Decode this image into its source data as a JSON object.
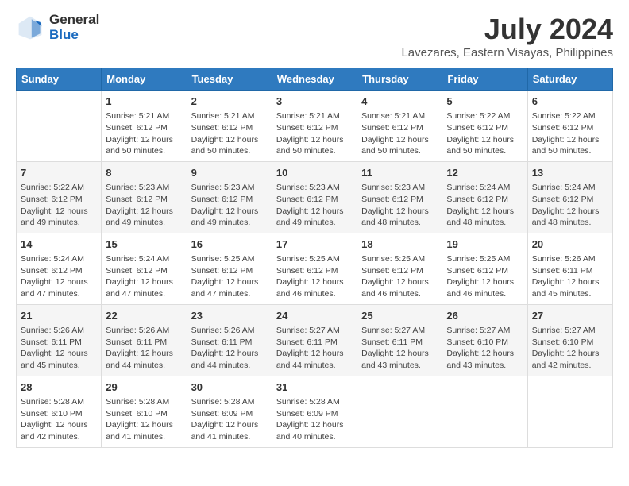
{
  "header": {
    "logo_line1": "General",
    "logo_line2": "Blue",
    "title": "July 2024",
    "subtitle": "Lavezares, Eastern Visayas, Philippines"
  },
  "columns": [
    "Sunday",
    "Monday",
    "Tuesday",
    "Wednesday",
    "Thursday",
    "Friday",
    "Saturday"
  ],
  "weeks": [
    {
      "days": [
        {
          "num": "",
          "info": ""
        },
        {
          "num": "1",
          "info": "Sunrise: 5:21 AM\nSunset: 6:12 PM\nDaylight: 12 hours\nand 50 minutes."
        },
        {
          "num": "2",
          "info": "Sunrise: 5:21 AM\nSunset: 6:12 PM\nDaylight: 12 hours\nand 50 minutes."
        },
        {
          "num": "3",
          "info": "Sunrise: 5:21 AM\nSunset: 6:12 PM\nDaylight: 12 hours\nand 50 minutes."
        },
        {
          "num": "4",
          "info": "Sunrise: 5:21 AM\nSunset: 6:12 PM\nDaylight: 12 hours\nand 50 minutes."
        },
        {
          "num": "5",
          "info": "Sunrise: 5:22 AM\nSunset: 6:12 PM\nDaylight: 12 hours\nand 50 minutes."
        },
        {
          "num": "6",
          "info": "Sunrise: 5:22 AM\nSunset: 6:12 PM\nDaylight: 12 hours\nand 50 minutes."
        }
      ]
    },
    {
      "days": [
        {
          "num": "7",
          "info": "Sunrise: 5:22 AM\nSunset: 6:12 PM\nDaylight: 12 hours\nand 49 minutes."
        },
        {
          "num": "8",
          "info": "Sunrise: 5:23 AM\nSunset: 6:12 PM\nDaylight: 12 hours\nand 49 minutes."
        },
        {
          "num": "9",
          "info": "Sunrise: 5:23 AM\nSunset: 6:12 PM\nDaylight: 12 hours\nand 49 minutes."
        },
        {
          "num": "10",
          "info": "Sunrise: 5:23 AM\nSunset: 6:12 PM\nDaylight: 12 hours\nand 49 minutes."
        },
        {
          "num": "11",
          "info": "Sunrise: 5:23 AM\nSunset: 6:12 PM\nDaylight: 12 hours\nand 48 minutes."
        },
        {
          "num": "12",
          "info": "Sunrise: 5:24 AM\nSunset: 6:12 PM\nDaylight: 12 hours\nand 48 minutes."
        },
        {
          "num": "13",
          "info": "Sunrise: 5:24 AM\nSunset: 6:12 PM\nDaylight: 12 hours\nand 48 minutes."
        }
      ]
    },
    {
      "days": [
        {
          "num": "14",
          "info": "Sunrise: 5:24 AM\nSunset: 6:12 PM\nDaylight: 12 hours\nand 47 minutes."
        },
        {
          "num": "15",
          "info": "Sunrise: 5:24 AM\nSunset: 6:12 PM\nDaylight: 12 hours\nand 47 minutes."
        },
        {
          "num": "16",
          "info": "Sunrise: 5:25 AM\nSunset: 6:12 PM\nDaylight: 12 hours\nand 47 minutes."
        },
        {
          "num": "17",
          "info": "Sunrise: 5:25 AM\nSunset: 6:12 PM\nDaylight: 12 hours\nand 46 minutes."
        },
        {
          "num": "18",
          "info": "Sunrise: 5:25 AM\nSunset: 6:12 PM\nDaylight: 12 hours\nand 46 minutes."
        },
        {
          "num": "19",
          "info": "Sunrise: 5:25 AM\nSunset: 6:12 PM\nDaylight: 12 hours\nand 46 minutes."
        },
        {
          "num": "20",
          "info": "Sunrise: 5:26 AM\nSunset: 6:11 PM\nDaylight: 12 hours\nand 45 minutes."
        }
      ]
    },
    {
      "days": [
        {
          "num": "21",
          "info": "Sunrise: 5:26 AM\nSunset: 6:11 PM\nDaylight: 12 hours\nand 45 minutes."
        },
        {
          "num": "22",
          "info": "Sunrise: 5:26 AM\nSunset: 6:11 PM\nDaylight: 12 hours\nand 44 minutes."
        },
        {
          "num": "23",
          "info": "Sunrise: 5:26 AM\nSunset: 6:11 PM\nDaylight: 12 hours\nand 44 minutes."
        },
        {
          "num": "24",
          "info": "Sunrise: 5:27 AM\nSunset: 6:11 PM\nDaylight: 12 hours\nand 44 minutes."
        },
        {
          "num": "25",
          "info": "Sunrise: 5:27 AM\nSunset: 6:11 PM\nDaylight: 12 hours\nand 43 minutes."
        },
        {
          "num": "26",
          "info": "Sunrise: 5:27 AM\nSunset: 6:10 PM\nDaylight: 12 hours\nand 43 minutes."
        },
        {
          "num": "27",
          "info": "Sunrise: 5:27 AM\nSunset: 6:10 PM\nDaylight: 12 hours\nand 42 minutes."
        }
      ]
    },
    {
      "days": [
        {
          "num": "28",
          "info": "Sunrise: 5:28 AM\nSunset: 6:10 PM\nDaylight: 12 hours\nand 42 minutes."
        },
        {
          "num": "29",
          "info": "Sunrise: 5:28 AM\nSunset: 6:10 PM\nDaylight: 12 hours\nand 41 minutes."
        },
        {
          "num": "30",
          "info": "Sunrise: 5:28 AM\nSunset: 6:09 PM\nDaylight: 12 hours\nand 41 minutes."
        },
        {
          "num": "31",
          "info": "Sunrise: 5:28 AM\nSunset: 6:09 PM\nDaylight: 12 hours\nand 40 minutes."
        },
        {
          "num": "",
          "info": ""
        },
        {
          "num": "",
          "info": ""
        },
        {
          "num": "",
          "info": ""
        }
      ]
    }
  ]
}
